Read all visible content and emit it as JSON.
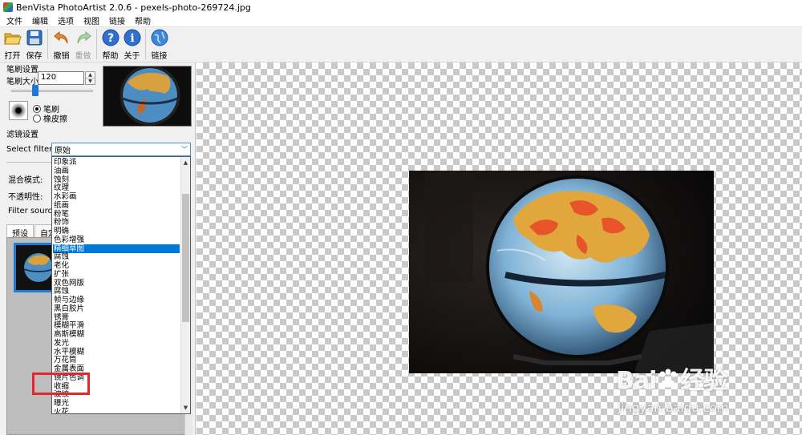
{
  "window": {
    "title": "BenVista PhotoArtist 2.0.6 - pexels-photo-269724.jpg"
  },
  "menu": [
    "文件",
    "编辑",
    "选项",
    "视图",
    "链接",
    "帮助"
  ],
  "toolbar": {
    "open": "打开",
    "save": "保存",
    "undo": "撤销",
    "redo": "重做",
    "help": "帮助",
    "about": "关于",
    "link": "链接"
  },
  "brush": {
    "section_title": "笔刷设置",
    "size_label": "笔刷大小:",
    "size_value": "120",
    "mode_brush": "笔刷",
    "mode_eraser": "橡皮擦"
  },
  "filter": {
    "section_title": "滤镜设置",
    "select_label": "Select filter:",
    "selected_value": "原始",
    "blend_label": "混合模式:",
    "opacity_label": "不透明性:",
    "source_label": "Filter source"
  },
  "tabs": {
    "preset": "预设",
    "custom": "自定"
  },
  "dropdown": {
    "items": [
      "印象派",
      "油画",
      "蚀刻",
      "纹理",
      "水彩画",
      "纸画",
      "粉笔",
      "粉饰",
      "明确",
      "色彩增强",
      "精细草图",
      "腐蚀",
      "老化",
      "扩张",
      "双色网版",
      "腐蚀",
      "帧与边缘",
      "黑白胶片",
      "锈膏",
      "模糊平滑",
      "高斯模糊",
      "发光",
      "水平模糊",
      "万花筒",
      "金属表面",
      "镜片色调",
      "收缩",
      "波纹",
      "曝光",
      "火花"
    ],
    "selected_index": 10
  },
  "watermark": {
    "logo_a": "Bai",
    "logo_b": "经验",
    "url": "jingyan.baidu.com"
  }
}
